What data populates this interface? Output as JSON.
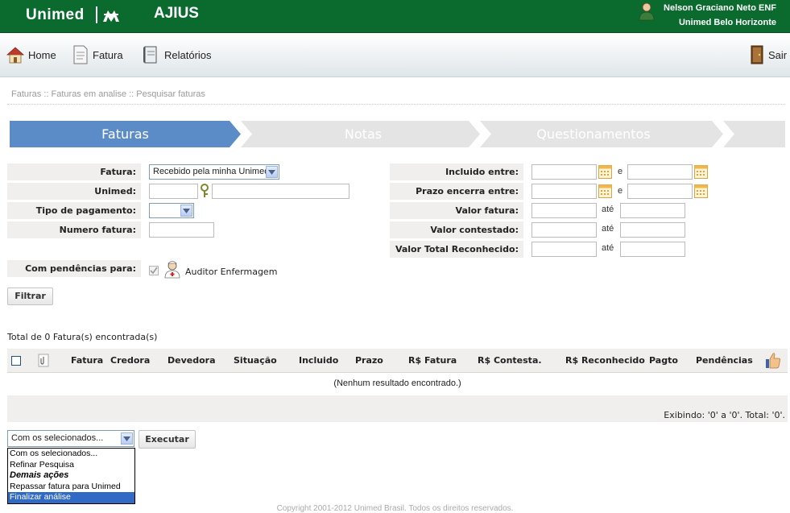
{
  "header": {
    "brand": "Unimed",
    "app_title": "AJIUS",
    "user_name": "Nelson Graciano Neto ENF",
    "user_unit": "Unimed Belo Horizonte"
  },
  "nav": {
    "home": "Home",
    "fatura": "Fatura",
    "relatorios": "Relatórios",
    "sair": "Sair"
  },
  "breadcrumb": "Faturas :: Faturas em analise :: Pesquisar faturas",
  "steps": [
    "Faturas",
    "Notas",
    "Questionamentos"
  ],
  "form": {
    "fatura_label": "Fatura:",
    "fatura_value": "Recebido pela minha Unimed",
    "unimed_label": "Unimed:",
    "tipo_label": "Tipo de pagamento:",
    "numero_label": "Numero fatura:",
    "pendencias_label": "Com pendências para:",
    "auditor": "Auditor Enfermagem",
    "incluido_label": "Incluido entre:",
    "prazo_label": "Prazo encerra entre:",
    "valor_fatura_label": "Valor fatura:",
    "valor_contestado_label": "Valor contestado:",
    "valor_total_label": "Valor Total Reconhecido:",
    "e": "e",
    "ate": "até",
    "filtrar": "Filtrar"
  },
  "results": {
    "total": "Total de 0 Fatura(s) encontrada(s)",
    "columns": [
      "Fatura",
      "Credora",
      "Devedora",
      "Situação",
      "Incluido",
      "Prazo",
      "R$ Fatura",
      "R$ Contesta.",
      "R$ Reconhecido",
      "Pagto",
      "Pendências"
    ],
    "empty": "(Nenhum resultado encontrado.)",
    "showing": "Exibindo: '0' a '0'. Total: '0'."
  },
  "bulk": {
    "selected": "Com os selecionados...",
    "options": [
      "Com os selecionados...",
      "Refinar Pesquisa",
      "Demais ações",
      "Repassar fatura para Unimed",
      "Finalizar análise"
    ],
    "executar": "Executar"
  },
  "copyright": "Copyright 2001-2012 Unimed Brasil. Todos os direitos reservados."
}
